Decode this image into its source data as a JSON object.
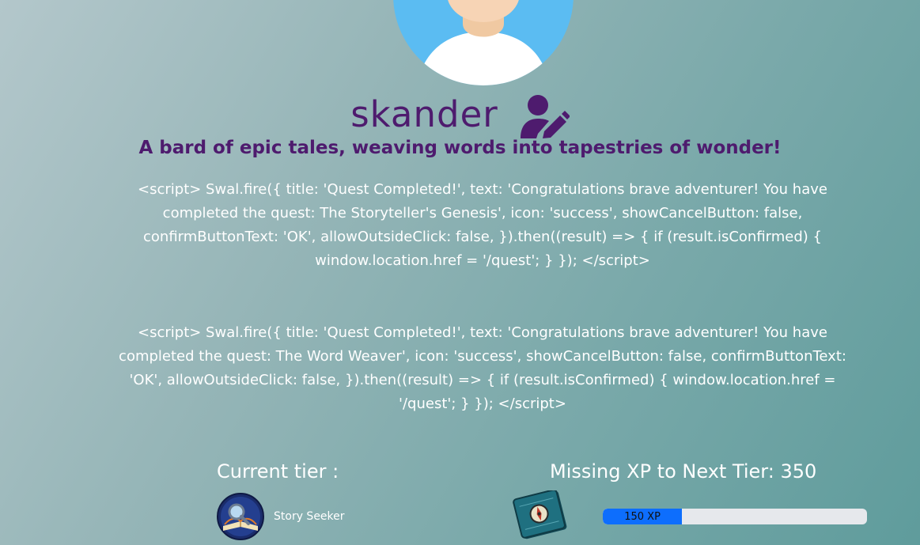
{
  "profile": {
    "username": "skander",
    "bio": "A bard of epic tales, weaving words into tapestries of wonder!",
    "avatar_icon": "avatar-icon",
    "edit_icon": "user-edit-icon"
  },
  "quest_messages": [
    "<script> Swal.fire({ title: 'Quest Completed!', text: 'Congratulations brave adventurer! You have completed the quest: The Storyteller's Genesis', icon: 'success', showCancelButton: false, confirmButtonText: 'OK', allowOutsideClick: false, }).then((result) => { if (result.isConfirmed) { window.location.href = '/quest'; } }); </script>",
    "<script> Swal.fire({ title: 'Quest Completed!', text: 'Congratulations brave adventurer! You have completed the quest: The Word Weaver', icon: 'success', showCancelButton: false, confirmButtonText: 'OK', allowOutsideClick: false, }).then((result) => { if (result.isConfirmed) { window.location.href = '/quest'; } }); </script>"
  ],
  "tier": {
    "current_label": "Current tier :",
    "current_name": "Story Seeker",
    "missing_label": "Missing XP to Next Tier: 350",
    "xp_label": "150 XP",
    "xp_progress_fraction": 0.3
  },
  "colors": {
    "accent_purple": "#4e1b6e",
    "progress_blue": "#0d6efd",
    "progress_track": "#e6e8ec"
  }
}
